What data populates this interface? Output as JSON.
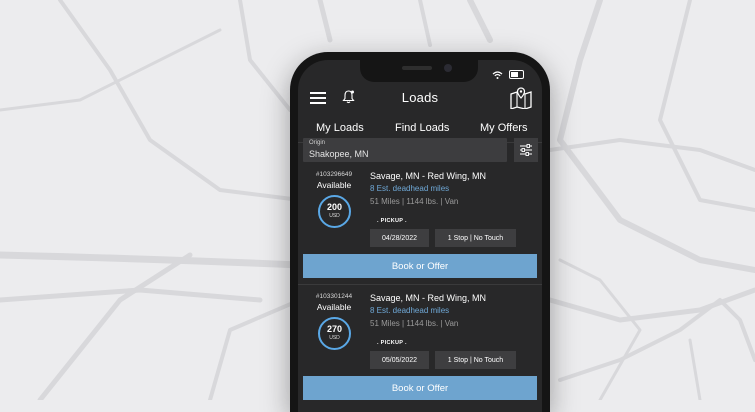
{
  "app": {
    "title": "Loads"
  },
  "tabs": [
    {
      "label": "My Loads",
      "active": false
    },
    {
      "label": "Find Loads",
      "active": true
    },
    {
      "label": "My Offers",
      "active": false
    }
  ],
  "search": {
    "origin_label": "Origin",
    "origin_value": "Shakopee, MN"
  },
  "icons": {
    "menu": "hamburger-icon",
    "notifications": "bell-icon",
    "map": "map-pin-icon",
    "filter": "sliders-icon",
    "wifi": "wifi-icon",
    "battery": "battery-icon"
  },
  "colors": {
    "accent": "#ef8a2e",
    "button": "#6ea4cf",
    "ring": "#5aa8e6",
    "deadhead_text": "#6fa8d6",
    "screen_bg": "#282829"
  },
  "loads": [
    {
      "id": "#103296649",
      "status": "Available",
      "price": "200",
      "currency": "USD",
      "route": "Savage, MN - Red Wing, MN",
      "deadhead": "8  Est. deadhead miles",
      "details": "51 Miles | 1144 lbs. | Van",
      "pickup_label": ". PICKUP .",
      "date": "04/28/2022",
      "stops": "1 Stop | No Touch",
      "book_label": "Book or Offer"
    },
    {
      "id": "#103301244",
      "status": "Available",
      "price": "270",
      "currency": "USD",
      "route": "Savage, MN - Red Wing, MN",
      "deadhead": "8  Est. deadhead miles",
      "details": "51 Miles | 1144 lbs. | Van",
      "pickup_label": ". PICKUP .",
      "date": "05/05/2022",
      "stops": "1 Stop | No Touch",
      "book_label": "Book or Offer"
    }
  ]
}
